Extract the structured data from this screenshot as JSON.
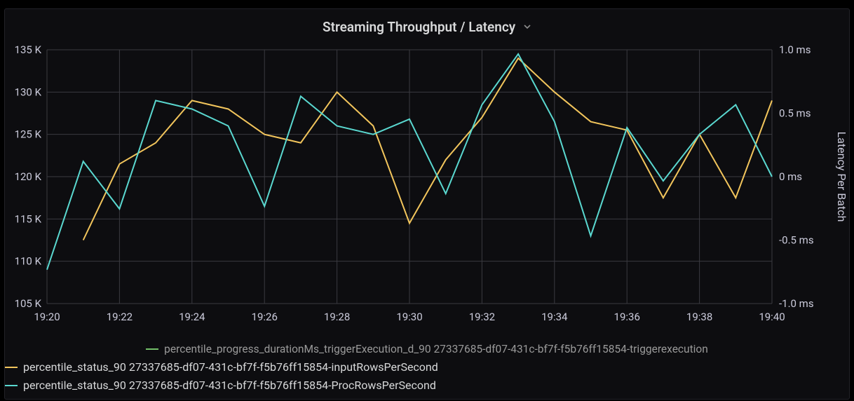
{
  "title": "Streaming Throughput / Latency",
  "chart_data": {
    "type": "line",
    "x_ticks": [
      "19:20",
      "19:22",
      "19:24",
      "19:26",
      "19:28",
      "19:30",
      "19:32",
      "19:34",
      "19:36",
      "19:38",
      "19:40"
    ],
    "x_categories": [
      "19:20",
      "19:21",
      "19:22",
      "19:23",
      "19:24",
      "19:25",
      "19:26",
      "19:27",
      "19:28",
      "19:29",
      "19:30",
      "19:31",
      "19:32",
      "19:33",
      "19:34",
      "19:35",
      "19:36",
      "19:37",
      "19:38",
      "19:39",
      "19:40"
    ],
    "y_left": {
      "ticks": [
        105,
        110,
        115,
        120,
        125,
        130,
        135
      ],
      "tick_labels": [
        "105 K",
        "110 K",
        "115 K",
        "120 K",
        "125 K",
        "130 K",
        "135 K"
      ],
      "range": [
        105,
        135
      ]
    },
    "y_right": {
      "ticks": [
        -1.0,
        -0.5,
        0.0,
        0.5,
        1.0
      ],
      "tick_labels": [
        "-1.0 ms",
        "-0.5 ms",
        "0 ms",
        "0.5 ms",
        "1.0 ms"
      ],
      "range": [
        -1.0,
        1.0
      ],
      "label": "Latency Per Batch"
    },
    "series": [
      {
        "name": "percentile_progress_durationMs_triggerExecution_d_90 27337685-df07-431c-bf7f-f5b76ff15854-triggerexecution",
        "color": "#73bf69",
        "axis": "right",
        "values": null
      },
      {
        "name": "percentile_status_90 27337685-df07-431c-bf7f-f5b76ff15854-inputRowsPerSecond",
        "color": "#f2c55c",
        "axis": "left",
        "values": [
          null,
          112.5,
          121.5,
          124.0,
          129.0,
          128.0,
          125.0,
          124.0,
          130.0,
          126.0,
          114.5,
          122.0,
          127.0,
          134.0,
          130.0,
          126.5,
          125.5,
          117.5,
          125.0,
          117.5,
          129.0
        ]
      },
      {
        "name": "percentile_status_90 27337685-df07-431c-bf7f-f5b76ff15854-ProcRowsPerSecond",
        "color": "#5ad8d0",
        "axis": "left",
        "values": [
          109.0,
          121.8,
          116.2,
          129.0,
          128.0,
          126.0,
          116.5,
          129.5,
          126.0,
          125.0,
          126.8,
          118.0,
          128.5,
          134.5,
          126.5,
          113.0,
          125.8,
          119.5,
          125.0,
          128.5,
          120.0
        ]
      }
    ]
  },
  "legend": [
    {
      "color": "#73bf69",
      "label": "percentile_progress_durationMs_triggerExecution_d_90 27337685-df07-431c-bf7f-f5b76ff15854-triggerexecution",
      "align": "center"
    },
    {
      "color": "#f2c55c",
      "label": "percentile_status_90 27337685-df07-431c-bf7f-f5b76ff15854-inputRowsPerSecond",
      "align": "left"
    },
    {
      "color": "#5ad8d0",
      "label": "percentile_status_90 27337685-df07-431c-bf7f-f5b76ff15854-ProcRowsPerSecond",
      "align": "left"
    }
  ]
}
